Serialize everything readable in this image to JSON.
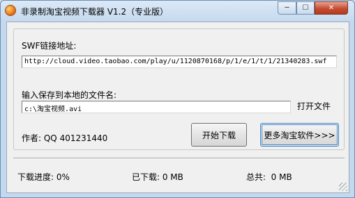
{
  "window": {
    "title": "非录制淘宝视频下载器 V1.2（专业版）",
    "controls": {
      "minimize": "─",
      "maximize": "☐",
      "close": "✕"
    }
  },
  "swf": {
    "label": "SWF链接地址:",
    "value": "http://cloud.video.taobao.com/play/u/1120870168/p/1/e/1/t/1/21340283.swf"
  },
  "save": {
    "label": "输入保存到本地的文件名:",
    "value": "c:\\淘宝视频.avi",
    "open_link": "打开文件"
  },
  "author": "作者: QQ 401231440",
  "buttons": {
    "start": "开始下载",
    "more": "更多淘宝软件>>>"
  },
  "status": {
    "progress": "下载进度: 0%",
    "downloaded": "已下载: 0 MB",
    "total": "总共:  0 MB"
  }
}
